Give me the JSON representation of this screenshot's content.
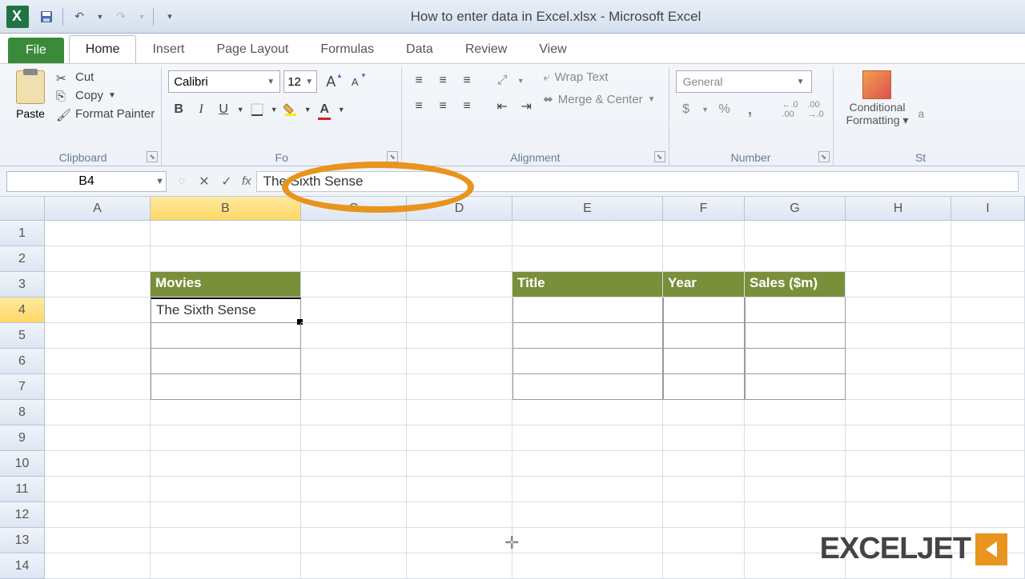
{
  "app": {
    "title": "How to enter data in Excel.xlsx - Microsoft Excel"
  },
  "qat": {
    "save": "💾",
    "undo": "↶",
    "redo": "↷"
  },
  "tabs": {
    "file": "File",
    "home": "Home",
    "insert": "Insert",
    "page_layout": "Page Layout",
    "formulas": "Formulas",
    "data": "Data",
    "review": "Review",
    "view": "View"
  },
  "ribbon": {
    "clipboard": {
      "paste": "Paste",
      "cut": "Cut",
      "copy": "Copy",
      "format_painter": "Format Painter",
      "label": "Clipboard"
    },
    "font": {
      "name": "Calibri",
      "size": "12",
      "grow": "A",
      "shrink": "A",
      "bold": "B",
      "italic": "I",
      "underline": "U",
      "label": "Font"
    },
    "alignment": {
      "wrap": "Wrap Text",
      "merge": "Merge & Center",
      "label": "Alignment"
    },
    "number": {
      "format": "General",
      "currency": "$",
      "percent": "%",
      "comma": ",",
      "inc": "←.0",
      "dec": ".00→",
      "label": "Number"
    },
    "styles": {
      "conditional": "Conditional Formatting",
      "label": "S"
    }
  },
  "formula_bar": {
    "name_box": "B4",
    "cancel": "✕",
    "enter": "✓",
    "fx": "fx",
    "value": "The Sixth Sense"
  },
  "columns": [
    "A",
    "B",
    "C",
    "D",
    "E",
    "F",
    "G",
    "H",
    "I"
  ],
  "rows": [
    "1",
    "2",
    "3",
    "4",
    "5",
    "6",
    "7",
    "8",
    "9",
    "10",
    "11",
    "12",
    "13",
    "14"
  ],
  "sheet_data": {
    "B3": "Movies",
    "B4": "The Sixth Sense",
    "E3": "Title",
    "F3": "Year",
    "G3": "Sales ($m)"
  },
  "active": {
    "col": "B",
    "row": "4"
  },
  "watermark": "EXCELJET"
}
